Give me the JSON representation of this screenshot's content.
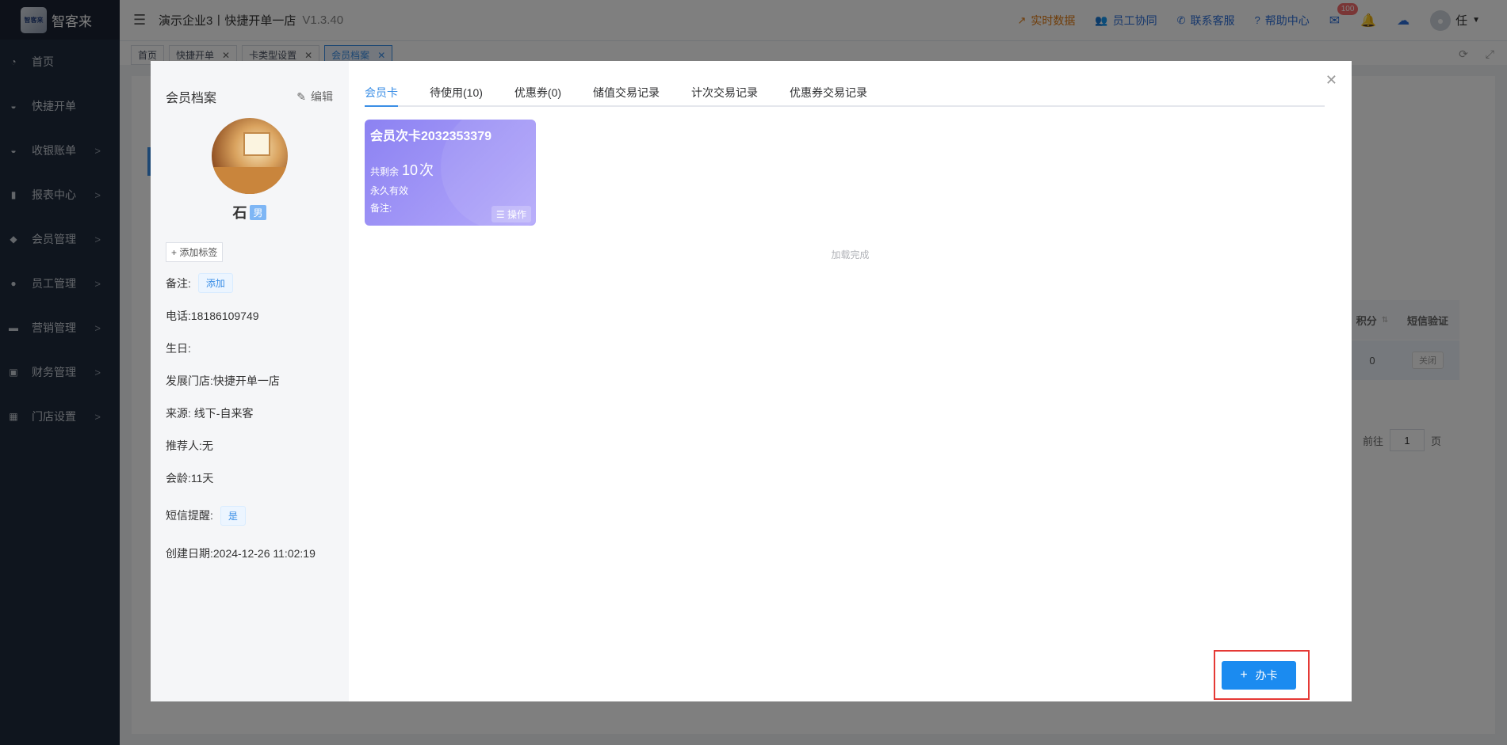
{
  "app": {
    "logo_text": "智客来",
    "logo_mark": "智客来",
    "title": "演示企业3丨快捷开单一店",
    "version": "V1.3.40"
  },
  "sidebar": {
    "items": [
      {
        "label": "首页",
        "icon": "dashboard-icon",
        "arrow": ""
      },
      {
        "label": "快捷开单",
        "icon": "bag-icon",
        "arrow": ""
      },
      {
        "label": "收银账单",
        "icon": "bag-icon",
        "arrow": ">"
      },
      {
        "label": "报表中心",
        "icon": "chart-icon",
        "arrow": ">"
      },
      {
        "label": "会员管理",
        "icon": "diamond-icon",
        "arrow": ">"
      },
      {
        "label": "员工管理",
        "icon": "user-icon",
        "arrow": ">"
      },
      {
        "label": "营销管理",
        "icon": "briefcase-icon",
        "arrow": ">"
      },
      {
        "label": "财务管理",
        "icon": "wallet-icon",
        "arrow": ">"
      },
      {
        "label": "门店设置",
        "icon": "grid-icon",
        "arrow": ">"
      }
    ]
  },
  "header": {
    "realtime": "实时数据",
    "staff": "员工协同",
    "support": "联系客服",
    "help": "帮助中心",
    "mail_badge": "100",
    "user": "任"
  },
  "tabs": [
    {
      "label": "首页",
      "closable": false
    },
    {
      "label": "快捷开单",
      "closable": true
    },
    {
      "label": "卡类型设置",
      "closable": true
    },
    {
      "label": "会员档案",
      "closable": true,
      "active": true
    }
  ],
  "background": {
    "col_points": "积分",
    "col_sms": "短信验证",
    "points_value": "0",
    "sms_value": "关闭",
    "goto": "前往",
    "page": "1",
    "page_suffix": "页"
  },
  "member": {
    "header": "会员档案",
    "edit": "编辑",
    "name": "石",
    "gender": "男",
    "add_tag": "+ 添加标签",
    "remark_label": "备注:",
    "remark_btn": "添加",
    "phone": "电话:18186109749",
    "birthday": "生日:",
    "store": "发展门店:快捷开单一店",
    "source": "来源: 线下-自来客",
    "referrer": "推荐人:无",
    "age": "会龄:11天",
    "sms_label": "短信提醒:",
    "sms_value": "是",
    "created": "创建日期:2024-12-26 11:02:19"
  },
  "detail_tabs": [
    "会员卡",
    "待使用(10)",
    "优惠券(0)",
    "储值交易记录",
    "计次交易记录",
    "优惠券交易记录"
  ],
  "card": {
    "title": "会员次卡2032353379",
    "remain_prefix": "共剩余",
    "remain_value": "10",
    "remain_unit": "次",
    "validity": "永久有效",
    "remark": "备注:",
    "op": "操作"
  },
  "loaded_text": "加载完成",
  "add_card_btn": "办卡",
  "colors": {
    "accent": "#3a8ee6",
    "card_purple": "#9a8ff5",
    "button_blue": "#1b8bf0",
    "highlight_red": "#e53935"
  }
}
